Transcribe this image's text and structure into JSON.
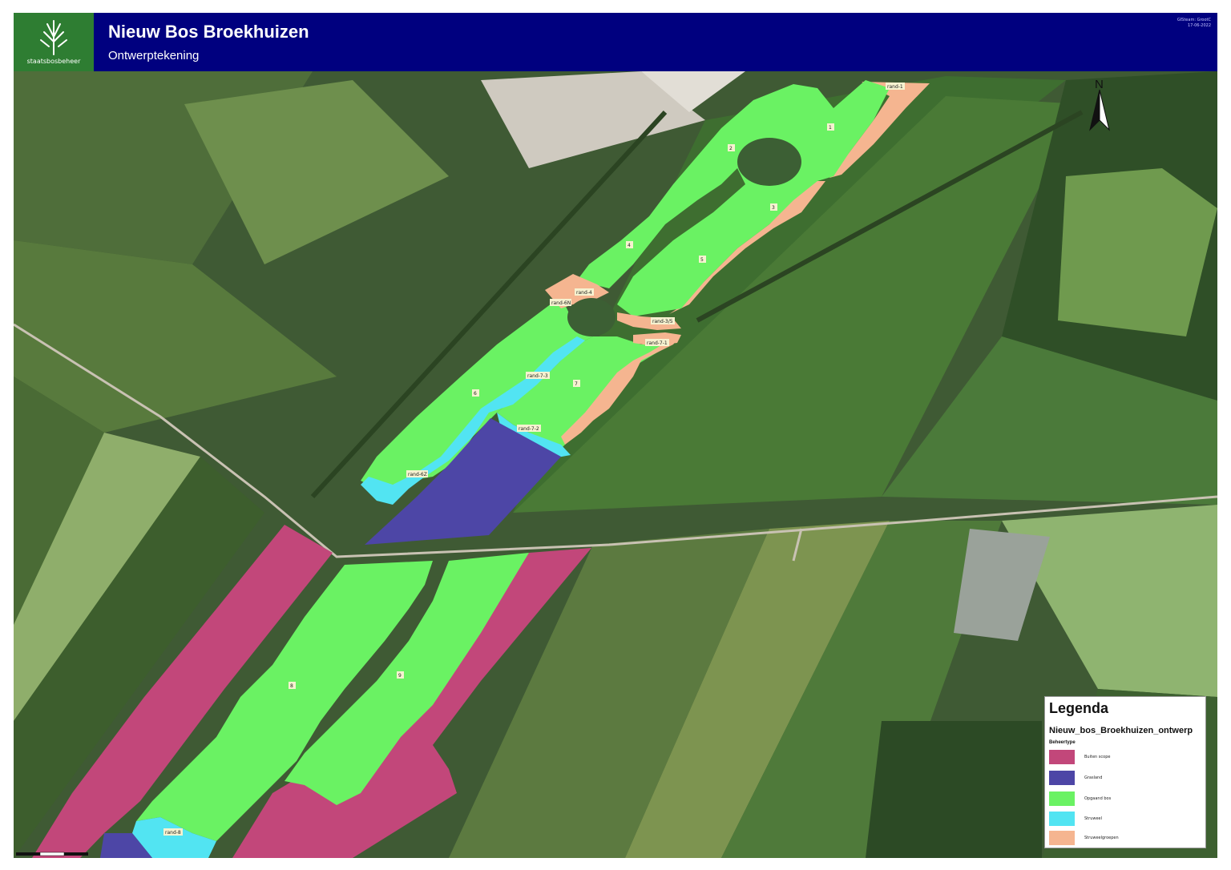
{
  "header": {
    "title": "Nieuw Bos Broekhuizen",
    "subtitle": "Ontwerptekening",
    "logo_text": "staatsbosbeheer",
    "meta_line1": "GISteam: GrootC",
    "meta_line2": "17-06-2022"
  },
  "map": {
    "north_label": "N",
    "colors": {
      "buiten_scope": "#c2477a",
      "grasland": "#4d46a6",
      "opgaand_bos": "#6af263",
      "struweel": "#52e4f2",
      "struweelgroepen": "#f5b590"
    },
    "parcel_labels": [
      "1",
      "2",
      "3",
      "4",
      "5",
      "6",
      "7",
      "8",
      "9"
    ],
    "edge_labels": [
      "rand-1",
      "rand-4",
      "rand-6N",
      "rand-3/5",
      "rand-7-1",
      "rand-7-3",
      "rand-7-2",
      "rand-6Z",
      "rand-8"
    ]
  },
  "legend": {
    "title": "Legenda",
    "layer": "Nieuw_bos_Broekhuizen_ontwerp",
    "group": "Beheertype",
    "items": [
      {
        "label": "Buiten scope",
        "color": "#c2477a"
      },
      {
        "label": "Grasland",
        "color": "#4d46a6"
      },
      {
        "label": "Opgaand bos",
        "color": "#6af263"
      },
      {
        "label": "Struweel",
        "color": "#52e4f2"
      },
      {
        "label": "Struweelgroepen",
        "color": "#f5b590"
      }
    ]
  }
}
